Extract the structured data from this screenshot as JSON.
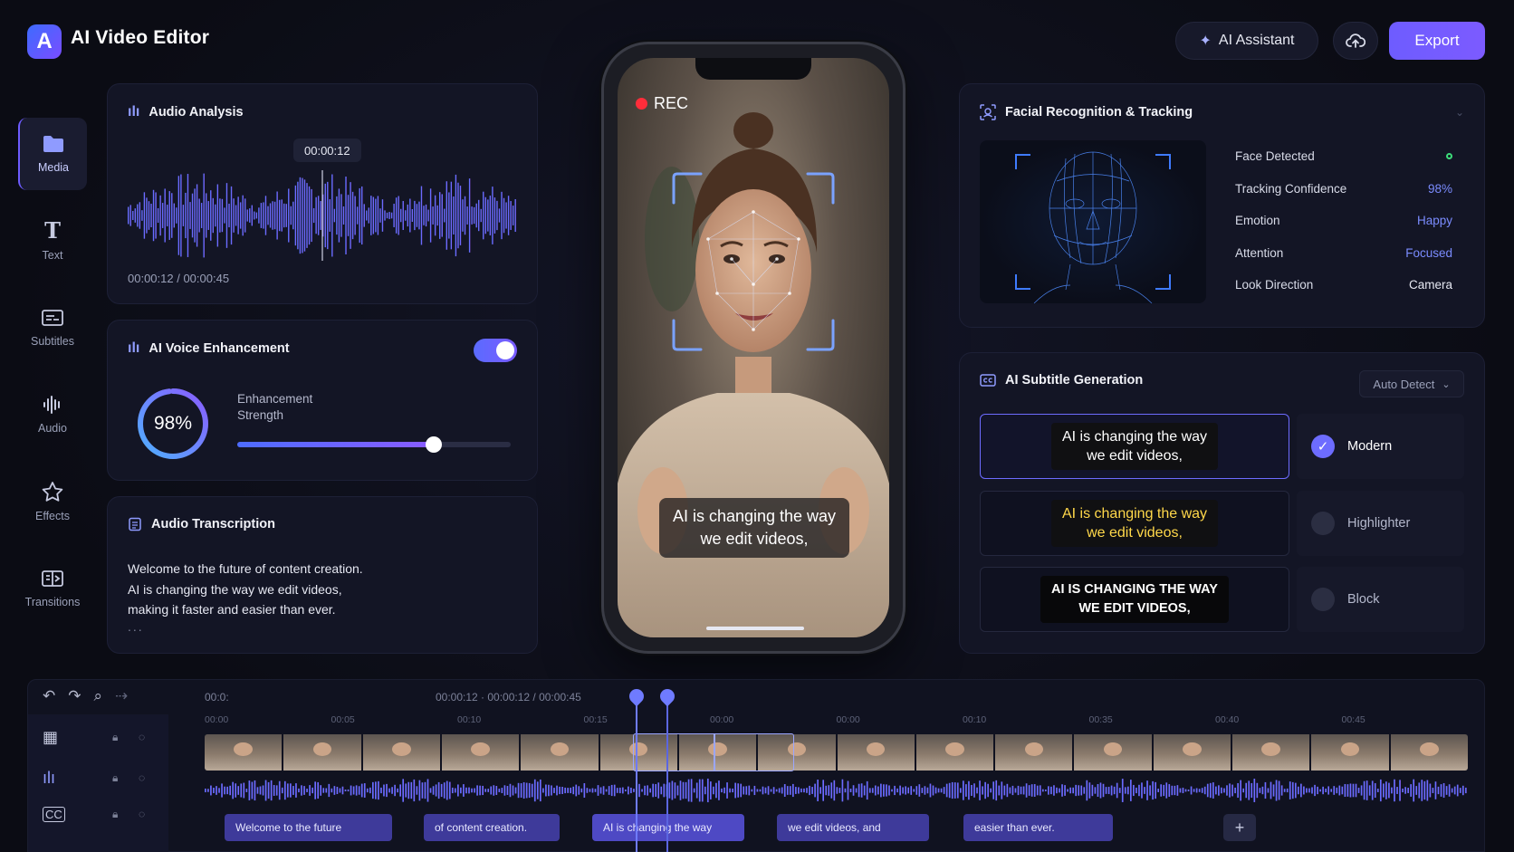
{
  "header": {
    "logo_letter": "A",
    "title": "AI Video Editor",
    "ai_assistant_label": "AI Assistant",
    "export_label": "Export"
  },
  "sidebar": {
    "items": [
      {
        "label": "Media",
        "icon": "folder-icon",
        "active": true
      },
      {
        "label": "Text",
        "icon": "text-icon"
      },
      {
        "label": "Subtitles",
        "icon": "subtitles-icon"
      },
      {
        "label": "Audio",
        "icon": "audio-wave-icon"
      },
      {
        "label": "Effects",
        "icon": "star-icon"
      },
      {
        "label": "Transitions",
        "icon": "transitions-icon"
      }
    ]
  },
  "audio_analysis": {
    "title": "Audio Analysis",
    "playhead_time": "00:00:12",
    "time_readout": "00:00:12 / 00:00:45"
  },
  "voice_enhancement": {
    "title": "AI Voice Enhancement",
    "enabled": true,
    "strength_value": "98%",
    "strength_fraction": 0.98,
    "strength_label": "Enhancement Strength",
    "slider_fraction": 0.72
  },
  "transcription": {
    "title": "Audio Transcription",
    "lines": [
      "Welcome to the future of content creation.",
      "AI is changing the way we edit videos,",
      "making it faster and easier than ever."
    ],
    "more": "..."
  },
  "phone": {
    "rec_label": "REC",
    "subtitle_line1": "AI is changing the way",
    "subtitle_line2": "we edit videos,"
  },
  "facial": {
    "title": "Facial Recognition & Tracking",
    "stats": [
      {
        "key": "Face Detected",
        "value": "",
        "status": "ok"
      },
      {
        "key": "Tracking Confidence",
        "value": "98%"
      },
      {
        "key": "Emotion",
        "value": "Happy"
      },
      {
        "key": "Attention",
        "value": "Focused"
      },
      {
        "key": "Look Direction",
        "value": "Camera"
      }
    ]
  },
  "subtitle_gen": {
    "title": "AI Subtitle Generation",
    "detect_label": "Auto Detect",
    "styles": [
      {
        "name": "Modern",
        "line1": "AI is changing the way",
        "line2": "we edit videos,",
        "selected": true,
        "text_color": "#ffffff"
      },
      {
        "name": "Highlighter",
        "line1": "AI is changing the way",
        "line2": "we edit videos,",
        "selected": false,
        "text_color": "#ffd84a"
      },
      {
        "name": "Block",
        "line1": "AI IS CHANGING THE WAY",
        "line2": "WE EDIT VIDEOS,",
        "selected": false,
        "text_color": "#ffffff"
      }
    ]
  },
  "timeline": {
    "timecode_left": "00:0:",
    "timecode_center": "00:00:12 · 00:00:12 / 00:00:45",
    "ruler": [
      "00:00",
      "00:05",
      "00:10",
      "00:15",
      "00:00",
      "00:00",
      "00:10",
      "00:35",
      "00:40",
      "00:45"
    ],
    "subtitle_chips": [
      "Welcome to the future",
      "of content creation.",
      "AI is changing the way",
      "we edit videos, and",
      "easier than ever."
    ]
  },
  "colors": {
    "accent": "#6e5cff",
    "background": "#0b0c14",
    "card": "#131525",
    "success": "#3ddc7a"
  }
}
